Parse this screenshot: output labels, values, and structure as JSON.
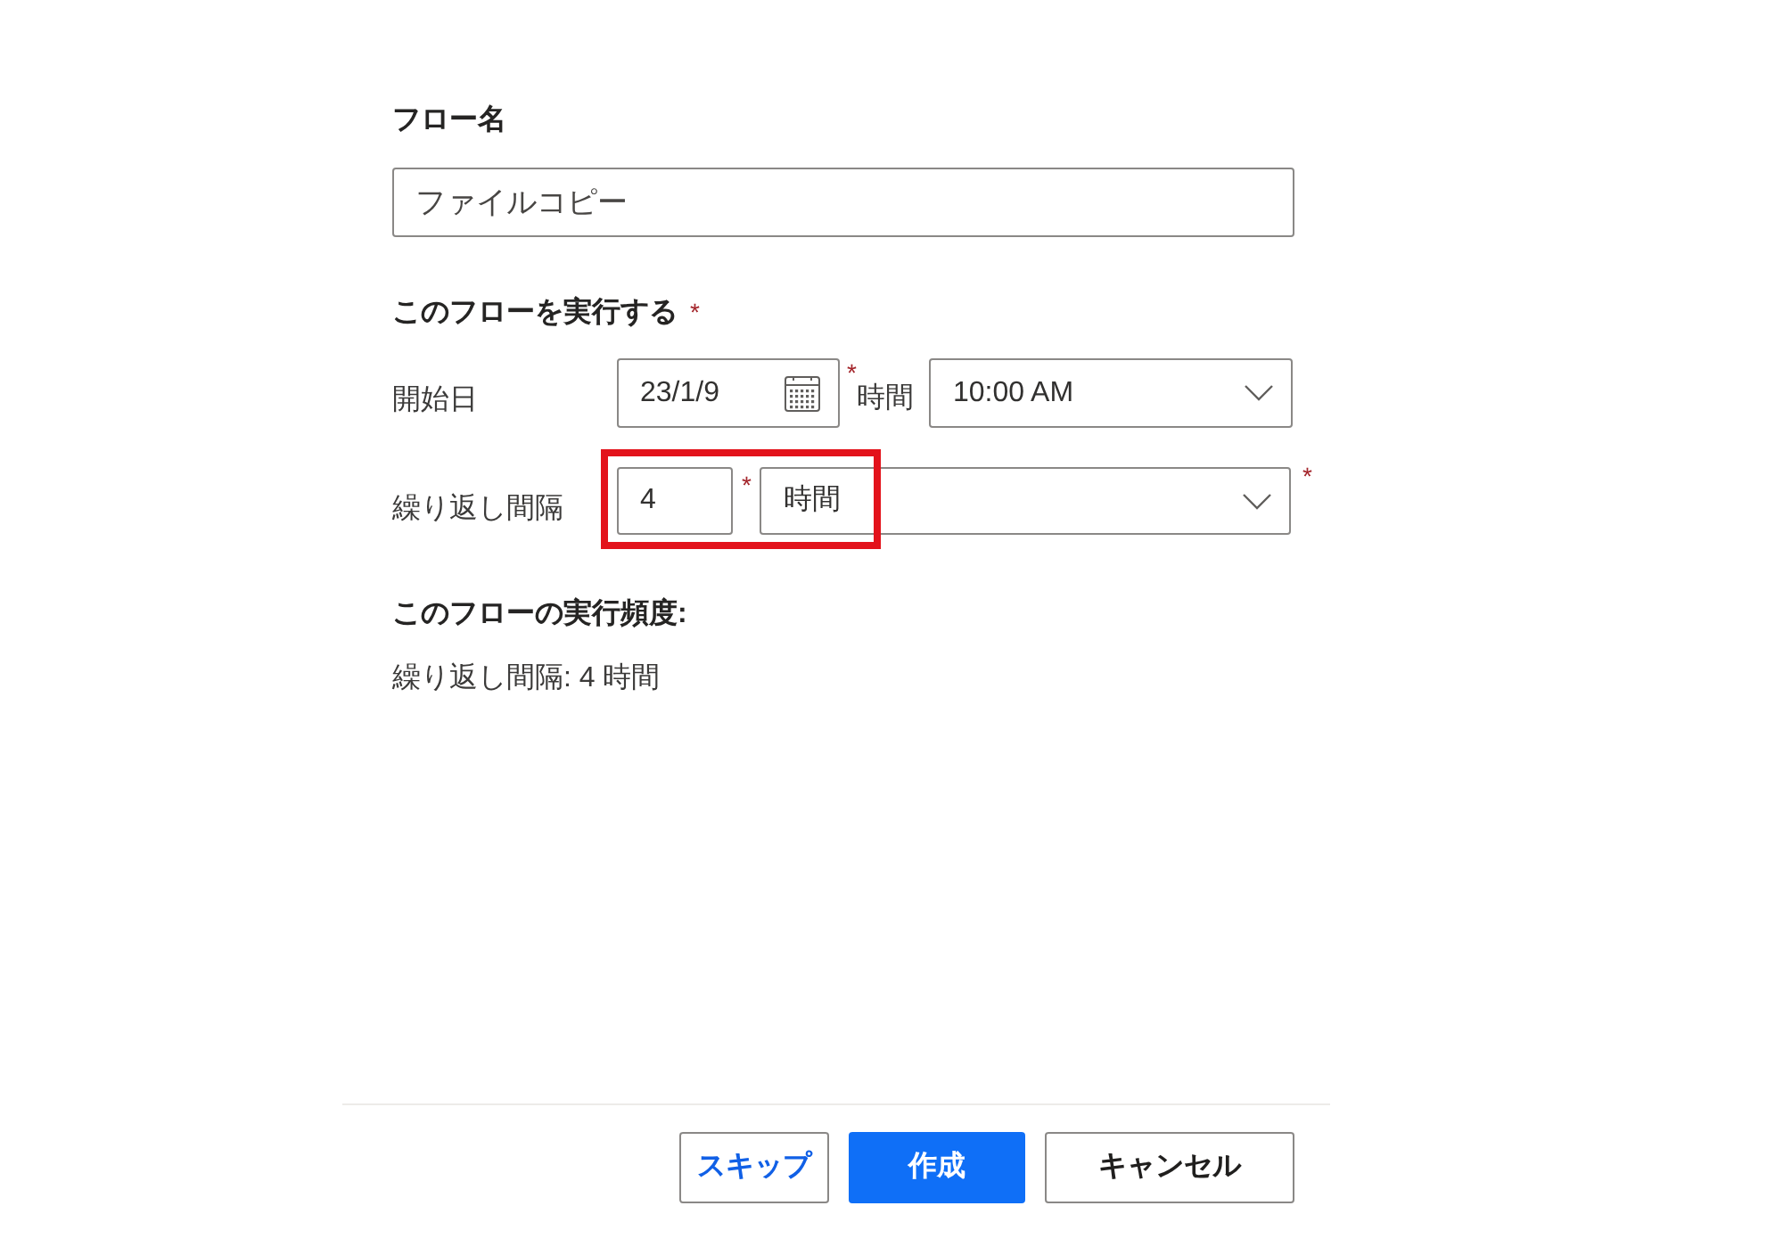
{
  "flow_name": {
    "label": "フロー名",
    "value": "ファイルコピー"
  },
  "schedule": {
    "heading": "このフローを実行する",
    "heading_mark": "*",
    "start": {
      "label": "開始日",
      "date": "23/1/9",
      "date_mark": "*",
      "time_label": "時間",
      "time": "10:00 AM"
    },
    "interval": {
      "label": "繰り返し間隔",
      "count": "4",
      "count_mark": "*",
      "unit": "時間",
      "unit_mark": "*",
      "highlighted": true
    }
  },
  "summary": {
    "heading": "このフローの実行頻度:",
    "text": "繰り返し間隔: 4 時間"
  },
  "buttons": [
    {
      "label": "スキップ",
      "kind": "link"
    },
    {
      "label": "作成",
      "kind": "primary"
    },
    {
      "label": "キャンセル",
      "kind": "default"
    }
  ]
}
